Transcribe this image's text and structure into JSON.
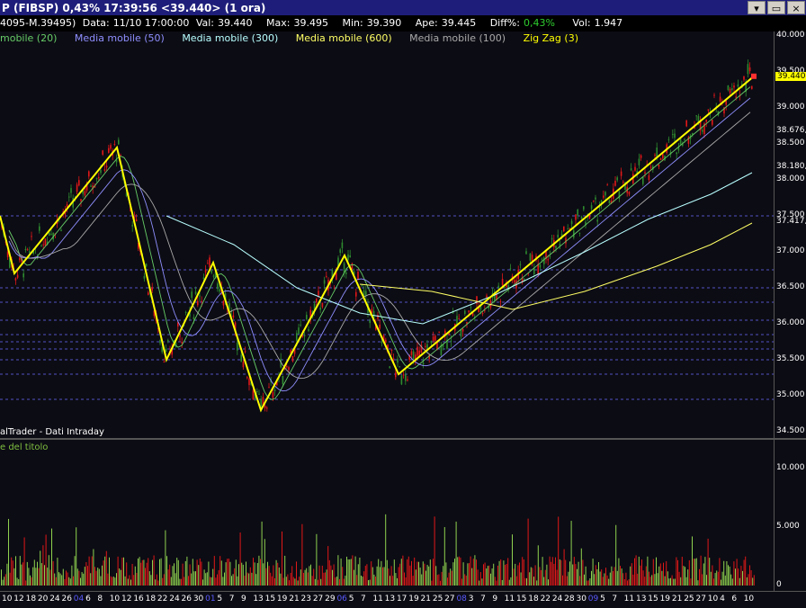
{
  "window": {
    "title": "P (FIBSP) 0,43% 17:39:56 <39.440> (1 ora)",
    "buttons": [
      "▾",
      "▭",
      "×"
    ]
  },
  "infobar": {
    "instrument": "4095-M.39495)",
    "data_label": "Data:",
    "data_value": "11/10 17:00:00",
    "val_label": "Val:",
    "val_value": "39.440",
    "max_label": "Max:",
    "max_value": "39.495",
    "min_label": "Min:",
    "min_value": "39.390",
    "ape_label": "Ape:",
    "ape_value": "39.445",
    "diff_label": "Diff%:",
    "diff_value": "0,43%",
    "vol_label": "Vol:",
    "vol_value": "1.947"
  },
  "indicators": [
    {
      "label": "mobile (20)",
      "color": "#66cc66"
    },
    {
      "label": "Media mobile (50)",
      "color": "#8f8fff"
    },
    {
      "label": "Media mobile (300)",
      "color": "#b8ffff"
    },
    {
      "label": "Media mobile (600)",
      "color": "#ffff66"
    },
    {
      "label": "Media mobile (100)",
      "color": "#aaaaaa"
    },
    {
      "label": "Zig Zag (3)",
      "color": "#ffff00"
    }
  ],
  "source_label": "alTrader - Dati Intraday",
  "volume_label": "e del titolo",
  "last_price_label": "39.440",
  "colors": {
    "up": "#2e8b2e",
    "down": "#e01818",
    "neutral": "#888888",
    "zigzag": "#ffff00",
    "volume": "#8fd14f",
    "hline": "#6a6aff"
  },
  "chart_data": {
    "type": "candlestick",
    "price_axis": {
      "ylim": [
        34.5,
        40.0
      ],
      "ticks": [
        "40.000",
        "39.500",
        "39.000",
        "38.676,7",
        "38.500",
        "38.180,7",
        "38.000",
        "37.500",
        "37.417,3",
        "37.000",
        "36.500",
        "36.000",
        "35.500",
        "35.000",
        "34.500"
      ]
    },
    "volume_axis": {
      "ylim": [
        0,
        12000
      ],
      "ticks": [
        "10.000",
        "5.000",
        "0"
      ]
    },
    "x_tick_labels": [
      "10",
      "12",
      "18",
      "20",
      "24",
      "26",
      "04",
      "6",
      "8",
      "10",
      "12",
      "16",
      "18",
      "22",
      "24",
      "26",
      "30",
      "01",
      "5",
      "7",
      "9",
      "13",
      "15",
      "19",
      "21",
      "23",
      "27",
      "29",
      "06",
      "5",
      "7",
      "11",
      "13",
      "17",
      "19",
      "21",
      "25",
      "27",
      "08",
      "3",
      "7",
      "9",
      "11",
      "15",
      "18",
      "22",
      "24",
      "28",
      "30",
      "09",
      "5",
      "7",
      "11",
      "13",
      "15",
      "19",
      "21",
      "25",
      "27",
      "10",
      "4",
      "6",
      "10"
    ],
    "horizontal_levels": [
      37.5,
      36.75,
      36.5,
      36.3,
      36.05,
      35.85,
      35.75,
      35.65,
      35.5,
      35.3,
      34.95
    ],
    "zigzag": [
      [
        0,
        37.5
      ],
      [
        16,
        36.7
      ],
      [
        130,
        38.45
      ],
      [
        185,
        35.5
      ],
      [
        237,
        36.85
      ],
      [
        290,
        34.8
      ],
      [
        383,
        36.95
      ],
      [
        443,
        35.3
      ],
      [
        838,
        39.44
      ]
    ],
    "moving_averages": [
      {
        "label": "Media mobile (300)",
        "values": [
          [
            185,
            37.5
          ],
          [
            260,
            37.1
          ],
          [
            330,
            36.5
          ],
          [
            400,
            36.15
          ],
          [
            470,
            36.0
          ],
          [
            550,
            36.4
          ],
          [
            650,
            37.0
          ],
          [
            720,
            37.45
          ],
          [
            790,
            37.8
          ],
          [
            836,
            38.1
          ]
        ]
      },
      {
        "label": "Media mobile (600)",
        "values": [
          [
            400,
            36.55
          ],
          [
            480,
            36.45
          ],
          [
            570,
            36.2
          ],
          [
            650,
            36.45
          ],
          [
            730,
            36.8
          ],
          [
            790,
            37.1
          ],
          [
            836,
            37.4
          ]
        ]
      }
    ],
    "last": 39.44
  }
}
